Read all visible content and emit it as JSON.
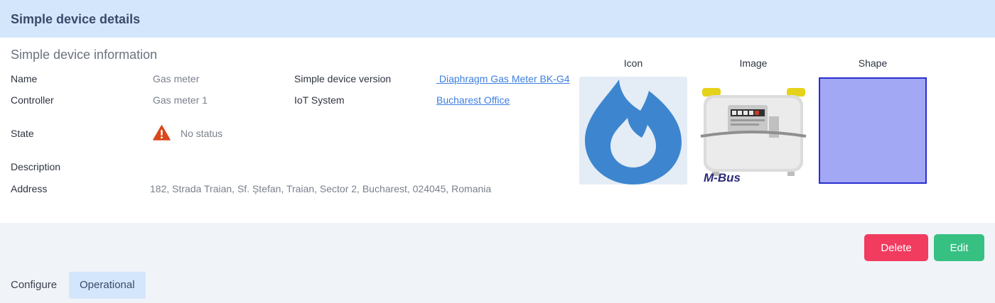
{
  "header": {
    "title": "Simple device details"
  },
  "info": {
    "section_title": "Simple device information",
    "name_label": "Name",
    "name_value": "Gas meter",
    "controller_label": "Controller",
    "controller_value": "Gas meter 1",
    "state_label": "State",
    "state_value": "No status",
    "description_label": "Description",
    "address_label": "Address",
    "address_value": "182, Strada Traian, Sf. Ștefan, Traian, Sector 2, Bucharest, 024045, Romania",
    "version_label": "Simple device version",
    "version_value": " Diaphragm Gas Meter BK-G4",
    "iot_label": "IoT System",
    "iot_value": "Bucharest Office"
  },
  "media": {
    "icon_label": "Icon",
    "image_label": "Image",
    "shape_label": "Shape",
    "image_logo_text": "M-Bus",
    "icon_name": "gas-flame-icon",
    "shape_color": "#a2a8f4"
  },
  "actions": {
    "delete_label": "Delete",
    "edit_label": "Edit"
  },
  "tabs": [
    {
      "label": "Configure",
      "active": false
    },
    {
      "label": "Operational",
      "active": true
    }
  ],
  "colors": {
    "header_bg": "#d4e6fb",
    "link": "#3d7fe0",
    "delete": "#f13b5f",
    "edit": "#36c082",
    "warning": "#d9471c"
  }
}
